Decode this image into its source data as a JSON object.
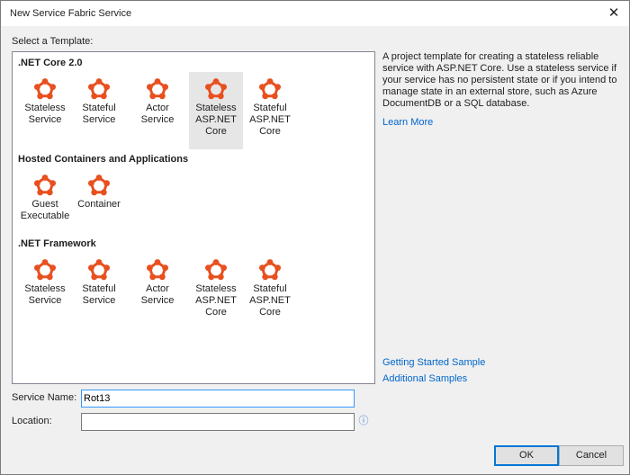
{
  "window": {
    "title": "New Service Fabric Service",
    "close_glyph": "✕"
  },
  "templates_label": "Select a Template:",
  "groups": [
    {
      "header": ".NET Core 2.0",
      "items": [
        "Stateless\nService",
        "Stateful\nService",
        "Actor Service",
        "Stateless\nASP.NET\nCore",
        "Stateful\nASP.NET\nCore"
      ]
    },
    {
      "header": "Hosted Containers and Applications",
      "items": [
        "Guest\nExecutable",
        "Container"
      ]
    },
    {
      "header": ".NET Framework",
      "items": [
        "Stateless\nService",
        "Stateful\nService",
        "Actor Service",
        "Stateless\nASP.NET\nCore",
        "Stateful\nASP.NET\nCore"
      ]
    }
  ],
  "selected_template": ".NET Core 2.0 / Stateless ASP.NET Core",
  "description": "A project template for creating a stateless reliable service with ASP.NET Core. Use a stateless service if your service has no persistent state or if you intend to manage state in an external store, such as Azure DocumentDB or a SQL database.",
  "links": {
    "learn_more": "Learn More",
    "getting_started": "Getting Started Sample",
    "additional": "Additional Samples"
  },
  "form": {
    "service_name_label": "Service Name:",
    "service_name_value": "Rot13",
    "location_label": "Location:",
    "location_value": "",
    "info_glyph": "ⓘ"
  },
  "buttons": {
    "ok": "OK",
    "cancel": "Cancel"
  },
  "colors": {
    "icon": "#e8501f",
    "link": "#0066cc",
    "accent": "#0078d7",
    "selected_tile": "#e6e6e6"
  },
  "icons": {
    "template": "service-fabric-icon",
    "info": "info-icon",
    "close": "close-icon"
  }
}
